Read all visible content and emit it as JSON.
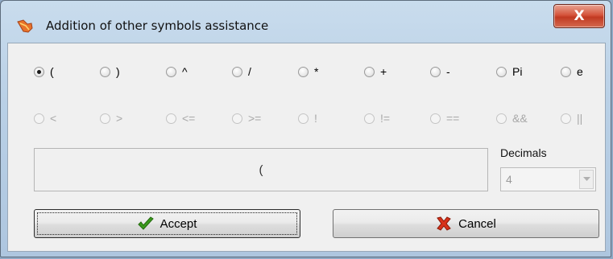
{
  "window": {
    "title": "Addition of other symbols assistance",
    "close_label": "X"
  },
  "operators": [
    {
      "label": "(",
      "checked": true,
      "enabled": true
    },
    {
      "label": ")",
      "checked": false,
      "enabled": true
    },
    {
      "label": "^",
      "checked": false,
      "enabled": true
    },
    {
      "label": "/",
      "checked": false,
      "enabled": true
    },
    {
      "label": "*",
      "checked": false,
      "enabled": true
    },
    {
      "label": "+",
      "checked": false,
      "enabled": true
    },
    {
      "label": "-",
      "checked": false,
      "enabled": true
    },
    {
      "label": "Pi",
      "checked": false,
      "enabled": true
    },
    {
      "label": "e",
      "checked": false,
      "enabled": true
    }
  ],
  "comparisons": [
    {
      "label": "<",
      "checked": false,
      "enabled": false
    },
    {
      "label": ">",
      "checked": false,
      "enabled": false
    },
    {
      "label": "<=",
      "checked": false,
      "enabled": false
    },
    {
      "label": ">=",
      "checked": false,
      "enabled": false
    },
    {
      "label": "!",
      "checked": false,
      "enabled": false
    },
    {
      "label": "!=",
      "checked": false,
      "enabled": false
    },
    {
      "label": "==",
      "checked": false,
      "enabled": false
    },
    {
      "label": "&&",
      "checked": false,
      "enabled": false
    },
    {
      "label": "||",
      "checked": false,
      "enabled": false
    }
  ],
  "preview": {
    "text": "("
  },
  "decimals": {
    "label": "Decimals",
    "value": "4",
    "enabled": false
  },
  "buttons": {
    "accept": "Accept",
    "cancel": "Cancel"
  },
  "colors": {
    "accept_icon": "#3a9a1c",
    "cancel_icon": "#d8321a",
    "title_icon": "#e8722a"
  }
}
